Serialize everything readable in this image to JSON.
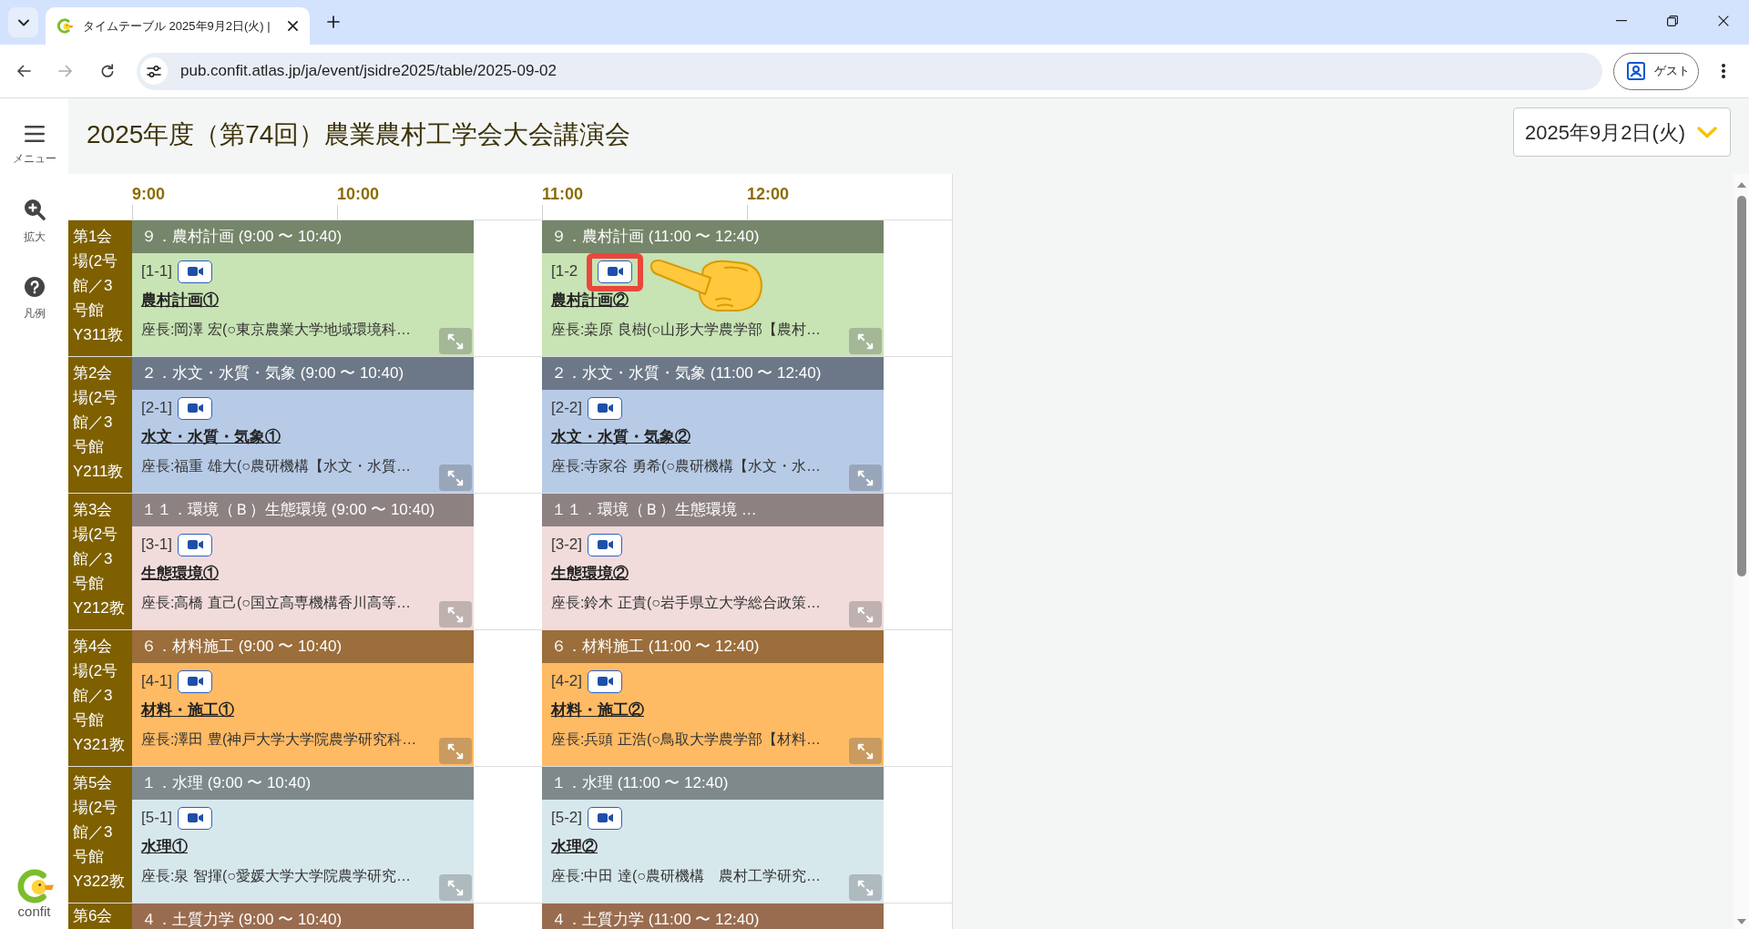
{
  "browser": {
    "tabs": [
      {
        "title": "タイムテーブル 2025年9月2日(火) |",
        "selected": true
      }
    ],
    "forward_disabled": true,
    "url": "pub.confit.atlas.jp/ja/event/jsidre2025/table/2025-09-02",
    "profile_label": "ゲスト"
  },
  "sidebar": {
    "items": [
      {
        "kind": "menu",
        "label": "メニュー"
      },
      {
        "kind": "zoom",
        "label": "拡大"
      },
      {
        "kind": "legend",
        "label": "凡例"
      }
    ],
    "logo_text": "confit"
  },
  "page_title": "2025年度（第74回）農業農村工学会大会講演会",
  "date_select": {
    "value": "2025年9月2日(火)"
  },
  "timetable": {
    "times": [
      "9:00",
      "10:00",
      "11:00",
      "12:00"
    ],
    "rooms": [
      {
        "label": "第1会場(2号館／3号館Y311教",
        "sessions": [
          {
            "header": "９．農村計画 (9:00 〜 10:40)",
            "color": "#76866a",
            "code": "[1-1]",
            "annotated": false,
            "title": "農村計画①",
            "chair": "座長:岡澤 宏(○東京農業大学地域環境科…"
          },
          {
            "header": "９．農村計画 (11:00 〜 12:40)",
            "color": "#76866a",
            "code": "[1-2",
            "annotated": true,
            "title": "農村計画②",
            "chair": "座長:桒原 良樹(○山形大学農学部【農村…"
          }
        ]
      },
      {
        "label": "第2会場(2号館／3号館Y211教",
        "sessions": [
          {
            "header": "２．水文・水質・気象 (9:00 〜 10:40)",
            "color": "#6c7888",
            "code": "[2-1]",
            "annotated": false,
            "title": "水文・水質・気象①",
            "chair": "座長:福重 雄大(○農研機構【水文・水質…"
          },
          {
            "header": "２．水文・水質・気象 (11:00 〜 12:40)",
            "color": "#6c7888",
            "code": "[2-2]",
            "annotated": false,
            "title": "水文・水質・気象②",
            "chair": "座長:寺家谷 勇希(○農研機構【水文・水…"
          }
        ]
      },
      {
        "label": "第3会場(2号館／3号館Y212教",
        "sessions": [
          {
            "header": "１１．環境（Ｂ）生態環境 (9:00 〜 10:40)",
            "color": "#8e8181",
            "code": "[3-1]",
            "annotated": false,
            "title": "生態環境①",
            "chair": "座長:高橋 直己(○国立高専機構香川高等…"
          },
          {
            "header": "１１．環境（Ｂ）生態環境 …",
            "color": "#8e8181",
            "code": "[3-2]",
            "annotated": false,
            "title": "生態環境②",
            "chair": "座長:鈴木 正貴(○岩手県立大学総合政策…"
          }
        ]
      },
      {
        "label": "第4会場(2号館／3号館Y321教",
        "sessions": [
          {
            "header": "６．材料施工 (9:00 〜 10:40)",
            "color": "#9b6e3b",
            "code": "[4-1]",
            "annotated": false,
            "title": "材料・施工①",
            "chair": "座長:澤田 豊(神戸大学大学院農学研究科…"
          },
          {
            "header": "６．材料施工 (11:00 〜 12:40)",
            "color": "#9b6e3b",
            "code": "[4-2]",
            "annotated": false,
            "title": "材料・施工②",
            "chair": "座長:兵頭 正浩(○鳥取大学農学部【材料…"
          }
        ]
      },
      {
        "label": "第5会場(2号館／3号館Y322教",
        "sessions": [
          {
            "header": "１．水理 (9:00 〜 10:40)",
            "color": "#7f898c",
            "code": "[5-1]",
            "annotated": false,
            "title": "水理①",
            "chair": "座長:泉 智揮(○愛媛大学大学院農学研究…"
          },
          {
            "header": "１．水理 (11:00 〜 12:40)",
            "color": "#7f898c",
            "code": "[5-2]",
            "annotated": false,
            "title": "水理②",
            "chair": "座長:中田 達(○農研機構　農村工学研究…"
          }
        ]
      },
      {
        "label": "第6会",
        "sessions": [
          {
            "header": "４．土質力学 (9:00 〜 10:40)",
            "color": "#9a6c4f"
          },
          {
            "header": "４．土質力学 (11:00 〜 12:40)",
            "color": "#9a6c4f"
          }
        ]
      }
    ]
  }
}
